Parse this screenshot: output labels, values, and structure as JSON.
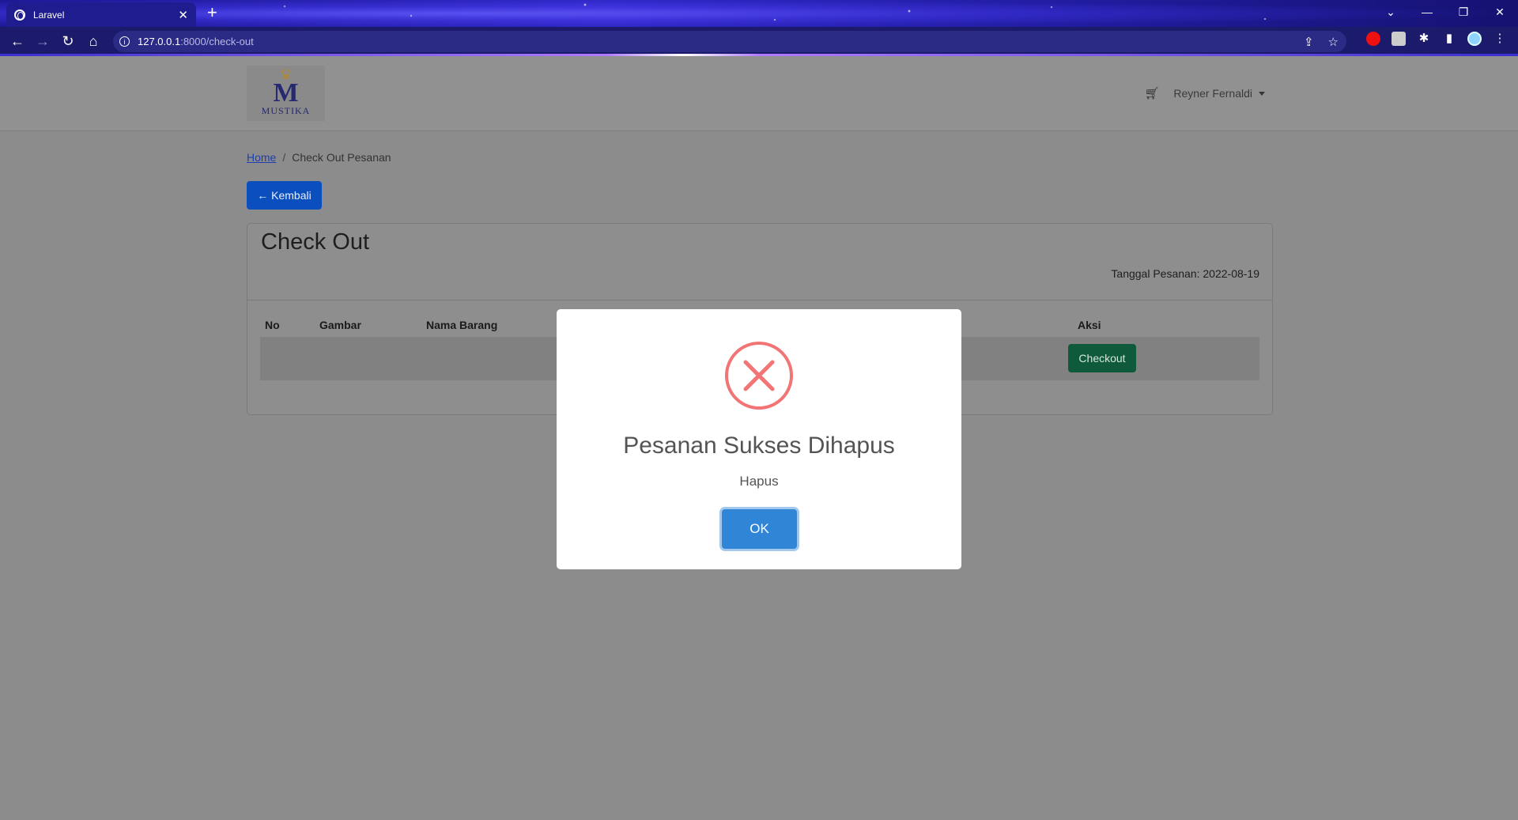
{
  "browser": {
    "tab_title": "Laravel",
    "url_host": "127.0.0.1",
    "url_path": ":8000/check-out"
  },
  "navbar": {
    "brand": "MUSTIKA",
    "user_name": "Reyner Fernaldi"
  },
  "breadcrumb": {
    "home": "Home",
    "separator": "/",
    "current": "Check Out Pesanan"
  },
  "back_button": "Kembali",
  "card": {
    "title": "Check Out",
    "order_date": "Tanggal Pesanan: 2022-08-19",
    "columns": [
      "No",
      "Gambar",
      "Nama Barang",
      "Aksi"
    ],
    "checkout_button": "Checkout"
  },
  "modal": {
    "icon": "error-x-icon",
    "title": "Pesanan Sukses Dihapus",
    "text": "Hapus",
    "ok_button": "OK",
    "icon_color": "#f27474",
    "button_color": "#3085d6"
  }
}
